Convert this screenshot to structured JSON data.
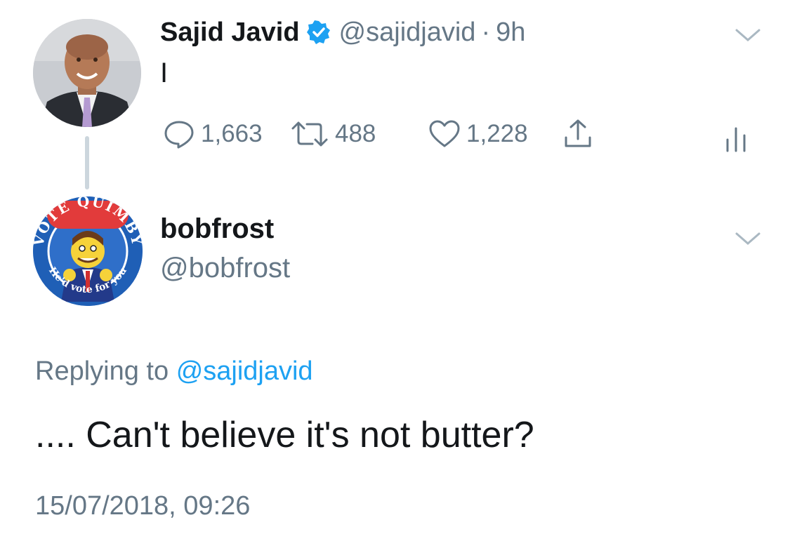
{
  "tweet": {
    "author": {
      "name": "Sajid Javid",
      "handle": "@sajidjavid",
      "separator": "·",
      "time": "9h",
      "verified": true,
      "avatar": "avatar-photo-man-in-suit"
    },
    "text": "I",
    "actions": {
      "reply": {
        "icon": "reply-icon",
        "count": "1,663"
      },
      "retweet": {
        "icon": "retweet-icon",
        "count": "488"
      },
      "like": {
        "icon": "heart-icon",
        "count": "1,228"
      },
      "share": {
        "icon": "share-icon"
      },
      "analytics": {
        "icon": "analytics-icon"
      }
    }
  },
  "reply": {
    "author": {
      "name": "bobfrost",
      "handle": "@bobfrost",
      "avatar": "avatar-vote-quimby-badge",
      "avatar_text_top": "VOTE QUIMBY",
      "avatar_text_bottom": "He'd vote for you"
    },
    "replying_label": "Replying to",
    "replying_to": "@sajidjavid",
    "text": ".... Can't believe it's not butter?",
    "timestamp": "15/07/2018, 09:26"
  },
  "colors": {
    "text": "#14171a",
    "secondary": "#657786",
    "accent": "#1da1f2",
    "thread_line": "#ccd6dd"
  }
}
